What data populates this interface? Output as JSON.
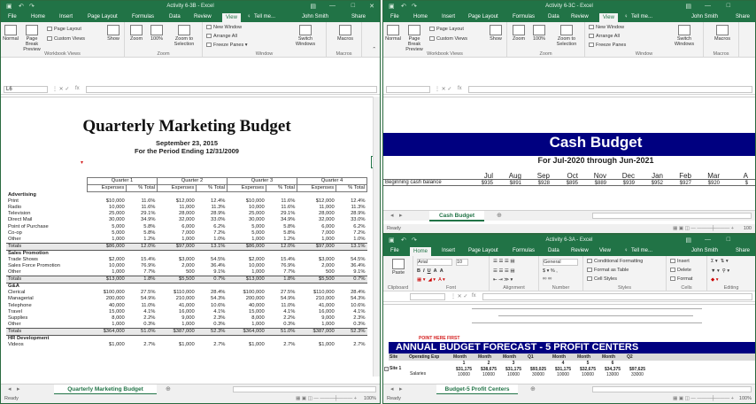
{
  "left": {
    "title": "Activity 6-3B - Excel",
    "user": "John Smith",
    "share": "Share",
    "tell": "Tell me...",
    "tabs": [
      "File",
      "Home",
      "Insert",
      "Page Layout",
      "Formulas",
      "Data",
      "Review",
      "View"
    ],
    "active_tab": "View",
    "ribbon": {
      "normal": "Normal",
      "page_break": "Page Break Preview",
      "page_layout": "Page Layout",
      "custom_views": "Custom Views",
      "workbook_views": "Workbook Views",
      "show": "Show",
      "zoom": "Zoom",
      "zoom100": "100%",
      "zoom_selection": "Zoom to Selection",
      "zoom_group": "Zoom",
      "new_window": "New Window",
      "arrange_all": "Arrange All",
      "freeze_panes": "Freeze Panes",
      "switch_windows": "Switch Windows",
      "window_group": "Window",
      "macros": "Macros",
      "macros_group": "Macros"
    },
    "name_box": "L6",
    "fx": "fx",
    "title_main": "Quarterly Marketing Budget",
    "date": "September 23, 2015",
    "period": "For the Period Ending 12/31/2009",
    "quarters": [
      "Quarter 1",
      "Quarter 2",
      "Quarter 3",
      "Quarter 4"
    ],
    "col_heads": [
      "Expenses",
      "% Total",
      "Expenses",
      "% Total",
      "Expenses",
      "% Total",
      "Expenses",
      "% Total"
    ],
    "rows": [
      {
        "type": "sect",
        "label": "Advertising",
        "cells": [
          "Expenses",
          "% Total",
          "Expenses",
          "% Total",
          "Expenses",
          "% Total",
          "Expenses",
          "% Total"
        ]
      },
      {
        "type": "row",
        "label": "Print",
        "cells": [
          "$10,000",
          "11.6%",
          "$12,000",
          "12.4%",
          "$10,000",
          "11.6%",
          "$12,000",
          "12.4%"
        ]
      },
      {
        "type": "row",
        "label": "Radio",
        "cells": [
          "10,000",
          "11.6%",
          "11,000",
          "11.3%",
          "10,000",
          "11.6%",
          "11,000",
          "11.3%"
        ]
      },
      {
        "type": "row",
        "label": "Television",
        "cells": [
          "25,000",
          "29.1%",
          "28,000",
          "28.9%",
          "25,000",
          "29.1%",
          "28,000",
          "28.9%"
        ]
      },
      {
        "type": "row",
        "label": "Direct Mail",
        "cells": [
          "30,000",
          "34.9%",
          "32,000",
          "33.0%",
          "30,000",
          "34.9%",
          "32,000",
          "33.0%"
        ]
      },
      {
        "type": "row",
        "label": "Point of Purchase",
        "cells": [
          "5,000",
          "5.8%",
          "6,000",
          "6.2%",
          "5,000",
          "5.8%",
          "6,000",
          "6.2%"
        ]
      },
      {
        "type": "row",
        "label": "Co-op",
        "cells": [
          "5,000",
          "5.8%",
          "7,000",
          "7.2%",
          "5,000",
          "5.8%",
          "7,000",
          "7.2%"
        ]
      },
      {
        "type": "row",
        "label": "Other",
        "cells": [
          "1,000",
          "1.2%",
          "1,000",
          "1.0%",
          "1,000",
          "1.2%",
          "1,000",
          "1.0%"
        ]
      },
      {
        "type": "tot",
        "label": "Totals",
        "cells": [
          "$86,000",
          "12.0%",
          "$97,000",
          "13.1%",
          "$86,000",
          "12.0%",
          "$97,000",
          "13.1%"
        ]
      },
      {
        "type": "sect",
        "label": "Sales Promotion",
        "cells": [
          "",
          "",
          "",
          "",
          "",
          "",
          "",
          ""
        ]
      },
      {
        "type": "row",
        "label": "Trade Shows",
        "cells": [
          "$2,000",
          "15.4%",
          "$3,000",
          "54.5%",
          "$2,000",
          "15.4%",
          "$3,000",
          "54.5%"
        ]
      },
      {
        "type": "row",
        "label": "Sales Force Promotion",
        "cells": [
          "10,000",
          "76.9%",
          "2,000",
          "36.4%",
          "10,000",
          "76.9%",
          "2,000",
          "36.4%"
        ]
      },
      {
        "type": "row",
        "label": "Other",
        "cells": [
          "1,000",
          "7.7%",
          "500",
          "9.1%",
          "1,000",
          "7.7%",
          "500",
          "9.1%"
        ]
      },
      {
        "type": "tot",
        "label": "Totals",
        "cells": [
          "$13,000",
          "1.8%",
          "$5,500",
          "0.7%",
          "$13,000",
          "1.8%",
          "$5,500",
          "0.7%"
        ]
      },
      {
        "type": "sect",
        "label": "G&A",
        "cells": [
          "",
          "",
          "",
          "",
          "",
          "",
          "",
          ""
        ]
      },
      {
        "type": "row",
        "label": "Clerical",
        "cells": [
          "$100,000",
          "27.5%",
          "$110,000",
          "28.4%",
          "$100,000",
          "27.5%",
          "$110,000",
          "28.4%"
        ]
      },
      {
        "type": "row",
        "label": "Managerial",
        "cells": [
          "200,000",
          "54.9%",
          "210,000",
          "54.3%",
          "200,000",
          "54.9%",
          "210,000",
          "54.3%"
        ]
      },
      {
        "type": "row",
        "label": "Telephone",
        "cells": [
          "40,000",
          "11.0%",
          "41,000",
          "10.6%",
          "40,000",
          "11.0%",
          "41,000",
          "10.6%"
        ]
      },
      {
        "type": "row",
        "label": "Travel",
        "cells": [
          "15,000",
          "4.1%",
          "16,000",
          "4.1%",
          "15,000",
          "4.1%",
          "16,000",
          "4.1%"
        ]
      },
      {
        "type": "row",
        "label": "Supplies",
        "cells": [
          "8,000",
          "2.2%",
          "9,000",
          "2.3%",
          "8,000",
          "2.2%",
          "9,000",
          "2.3%"
        ]
      },
      {
        "type": "row",
        "label": "Other",
        "cells": [
          "1,000",
          "0.3%",
          "1,000",
          "0.3%",
          "1,000",
          "0.3%",
          "1,000",
          "0.3%"
        ]
      },
      {
        "type": "tot",
        "label": "Totals",
        "cells": [
          "$364,000",
          "51.0%",
          "$387,000",
          "52.3%",
          "$364,000",
          "51.0%",
          "$387,000",
          "52.3%"
        ]
      },
      {
        "type": "sect",
        "label": "HR Development",
        "cells": [
          "",
          "",
          "",
          "",
          "",
          "",
          "",
          ""
        ]
      },
      {
        "type": "row",
        "label": "Videos",
        "cells": [
          "$1,000",
          "2.7%",
          "$1,000",
          "2.7%",
          "$1,000",
          "2.7%",
          "$1,000",
          "2.7%"
        ]
      }
    ],
    "sheet_tab": "Quarterly Marketing Budget",
    "status": "Ready",
    "zoom_pct": "100%"
  },
  "rt": {
    "title": "Activity 6-3C - Excel",
    "user": "John Smith",
    "share": "Share",
    "tell": "Tell me...",
    "tabs": [
      "File",
      "Home",
      "Insert",
      "Page Layout",
      "Formulas",
      "Data",
      "Review",
      "View"
    ],
    "active_tab": "View",
    "heading": "Cash Budget",
    "subheading": "For Jul-2020 through Jun-2021",
    "months": [
      "Jul",
      "Aug",
      "Sep",
      "Oct",
      "Nov",
      "Dec",
      "Jan",
      "Feb",
      "Mar",
      "A"
    ],
    "beg_label": "Beginning cash balance",
    "beg_values": [
      "$935",
      "$891",
      "$928",
      "$895",
      "$889",
      "$939",
      "$952",
      "$927",
      "$920",
      "$"
    ],
    "sheet_tab": "Cash Budget",
    "status": "Ready",
    "zoom_pct": "100"
  },
  "rb": {
    "title": "Activity 6-3A - Excel",
    "user": "John Smith",
    "share": "Share",
    "tell": "Tell me...",
    "tabs": [
      "File",
      "Home",
      "Insert",
      "Page Layout",
      "Formulas",
      "Data",
      "Review",
      "View"
    ],
    "active_tab": "Home",
    "font": "Arial",
    "size": "10",
    "format": "General",
    "cond_fmt": "Conditional Formatting",
    "fmt_table": "Format as Table",
    "cell_styles": "Cell Styles",
    "insert": "Insert",
    "delete": "Delete",
    "format_btn": "Format",
    "groups": [
      "Clipboard",
      "Font",
      "Alignment",
      "Number",
      "Styles",
      "Cells",
      "Editing"
    ],
    "paste": "Paste",
    "point_here": "POINT HERE FIRST",
    "banner": "ANNUAL BUDGET FORECAST - 5 PROFIT CENTERS",
    "col_heads": [
      "Site",
      "Operating Exp",
      "Month",
      "Month",
      "Month",
      "Q1",
      "Month",
      "Month",
      "Month",
      "Q2"
    ],
    "nums": [
      "1",
      "2",
      "3",
      "4",
      "5",
      "6"
    ],
    "site_label": "Site 1",
    "site_vals": [
      "$31,175",
      "$38,675",
      "$31,175",
      "$93,025",
      "$31,175",
      "$32,675",
      "$34,375",
      "$97,625"
    ],
    "salaries": "Salaries",
    "sal_vals": [
      "10000",
      "10000",
      "10000",
      "30000",
      "10000",
      "10000",
      "13000",
      "33000"
    ],
    "sheet_tab": "Budget-5 Profit Centers",
    "status": "Ready",
    "zoom_pct": "100%"
  },
  "colors": {
    "excel_green": "#217346",
    "banner_navy": "#000080",
    "point_red": "#d42020"
  }
}
